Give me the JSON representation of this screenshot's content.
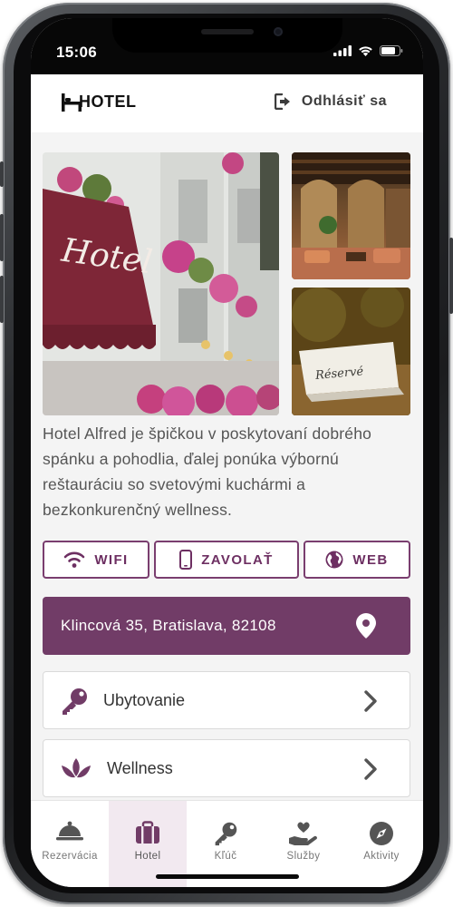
{
  "status_bar": {
    "time": "15:06"
  },
  "header": {
    "logo_text": "HOTEL",
    "logout_label": "Odhlásiť sa"
  },
  "hotel": {
    "photo_main_sign": "Hotel",
    "photo_card_text": "Réservé",
    "description": "Hotel Alfred je špičkou v poskytovaní dobrého spánku a pohodlia, ďalej ponúka výbornú reštauráciu so svetovými kuchármi a bezkonkurenčný wellness."
  },
  "actions": {
    "wifi": "WIFI",
    "call": "ZAVOLAŤ",
    "web": "WEB"
  },
  "address": {
    "text": "Klincová 35, Bratislava, 82108"
  },
  "menu": [
    {
      "label": "Ubytovanie",
      "icon": "key-icon"
    },
    {
      "label": "Wellness",
      "icon": "lotus-icon"
    }
  ],
  "tabs": [
    {
      "label": "Rezervácia",
      "icon": "cloche-icon"
    },
    {
      "label": "Hotel",
      "icon": "suitcase-icon",
      "active": true
    },
    {
      "label": "Kľúč",
      "icon": "key-icon"
    },
    {
      "label": "Služby",
      "icon": "hand-heart-icon"
    },
    {
      "label": "Aktivity",
      "icon": "compass-icon"
    }
  ],
  "colors": {
    "accent": "#713c67",
    "accent_text": "#6d2f62",
    "background": "#f4f4f4"
  }
}
